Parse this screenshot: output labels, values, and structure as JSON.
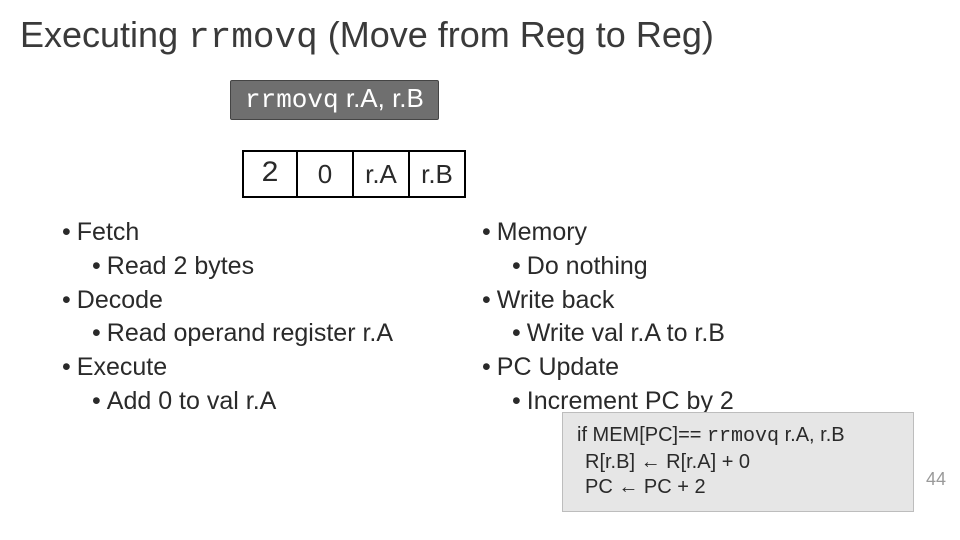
{
  "title": {
    "pre": "Executing ",
    "code": "rrmovq",
    "post": " (Move from Reg to Reg)"
  },
  "badge": {
    "code": "rrmovq",
    "args": " r.A,  r.B"
  },
  "encoding": {
    "c0": "2",
    "c1": "0",
    "c2": "r.A",
    "c3": "r.B"
  },
  "left": {
    "fetch": "Fetch",
    "fetch_sub": "Read 2 bytes",
    "decode": "Decode",
    "decode_sub": "Read operand register r.A",
    "execute": "Execute",
    "execute_sub": "Add 0 to val r.A"
  },
  "right": {
    "memory": "Memory",
    "memory_sub": "Do nothing",
    "writeback": "Write back",
    "writeback_sub": "Write val r.A to r.B",
    "pcupdate": "PC Update",
    "pcupdate_sub": "Increment PC by 2"
  },
  "pseudo": {
    "l1_pre": "if MEM[PC]== ",
    "l1_code": "rrmovq",
    "l1_post": " r.A, r.B",
    "l2": "R[r.B] ← R[r.A] + 0",
    "l3": "PC ← PC + 2"
  },
  "pagenum": "44"
}
